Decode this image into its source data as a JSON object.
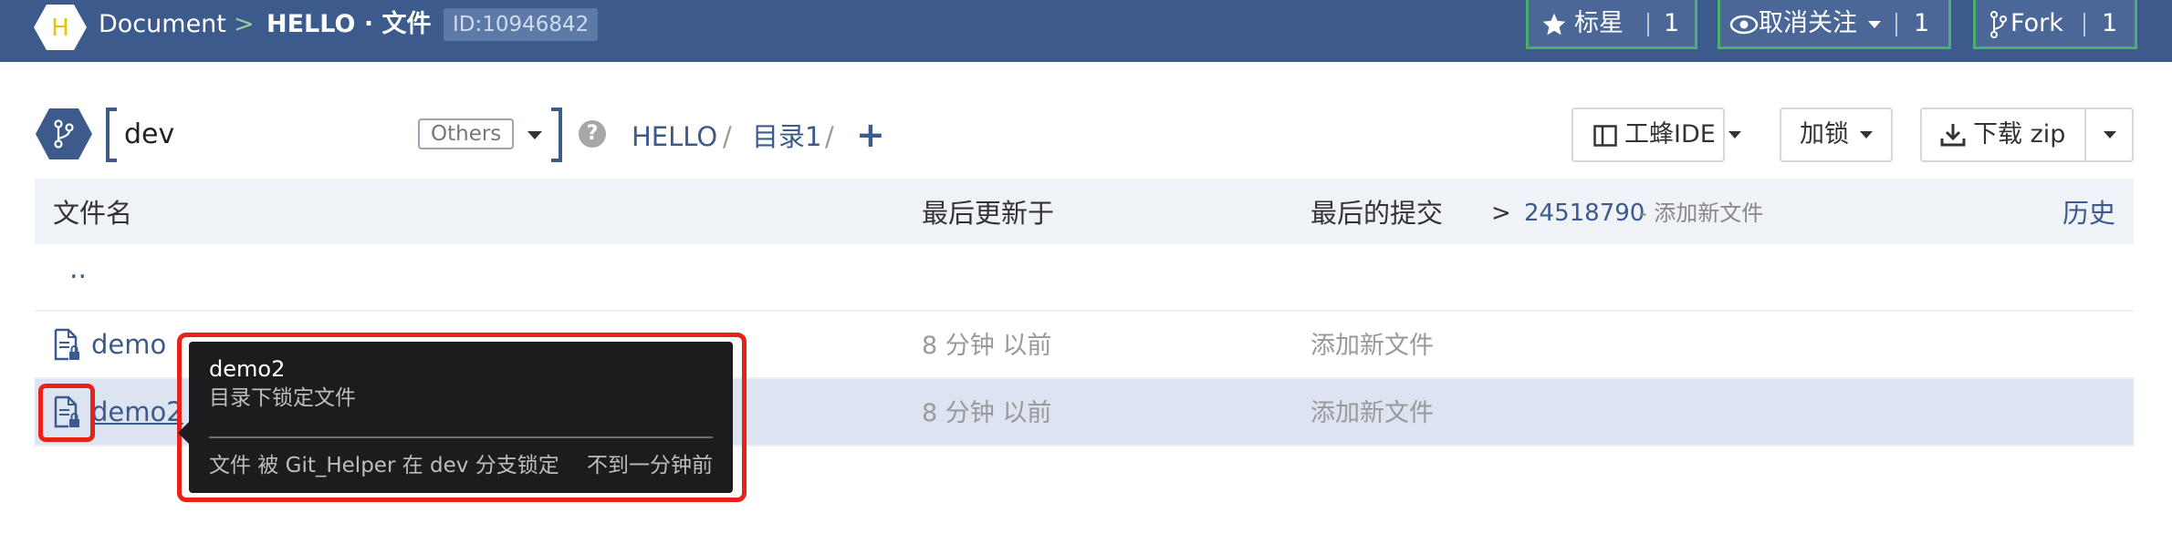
{
  "header": {
    "logo_letter": "H",
    "crumb_doc": "Document",
    "crumb_sep": ">",
    "crumb_repo": "HELLO · 文件",
    "repo_id": "ID:10946842",
    "star": {
      "label": "标星",
      "count": "1"
    },
    "watch": {
      "label": "取消关注",
      "count": "1"
    },
    "fork": {
      "label": "Fork",
      "count": "1"
    }
  },
  "toolbar": {
    "branch": "dev",
    "branch_tag": "Others",
    "help": "?",
    "path": [
      {
        "label": "HELLO"
      },
      {
        "label": "目录1"
      }
    ],
    "path_sep": "/",
    "add": "+",
    "ide_button": "工蜂IDE",
    "lock_button": "加锁",
    "download_button": "下载 zip"
  },
  "table": {
    "headers": {
      "name": "文件名",
      "updated": "最后更新于",
      "commit": "最后的提交"
    },
    "commit_arrow": ">",
    "commit_hash": "24518790",
    "commit_msg": "- 添加新文件",
    "history": "历史",
    "parent": "..",
    "rows": [
      {
        "name": "demo",
        "time": "8 分钟 以前",
        "msg": "添加新文件"
      },
      {
        "name": "demo2",
        "time": "8 分钟 以前",
        "msg": "添加新文件"
      }
    ]
  },
  "tooltip": {
    "title": "demo2",
    "subtitle": "目录下锁定文件",
    "info": "文件 被 Git_Helper 在 dev 分支锁定",
    "time": "不到一分钟前"
  },
  "colors": {
    "brand": "#3d5a8c",
    "topbar_button_border": "#4caf6e",
    "highlight_red": "#e8221b",
    "selected_row": "#dce4f2"
  }
}
